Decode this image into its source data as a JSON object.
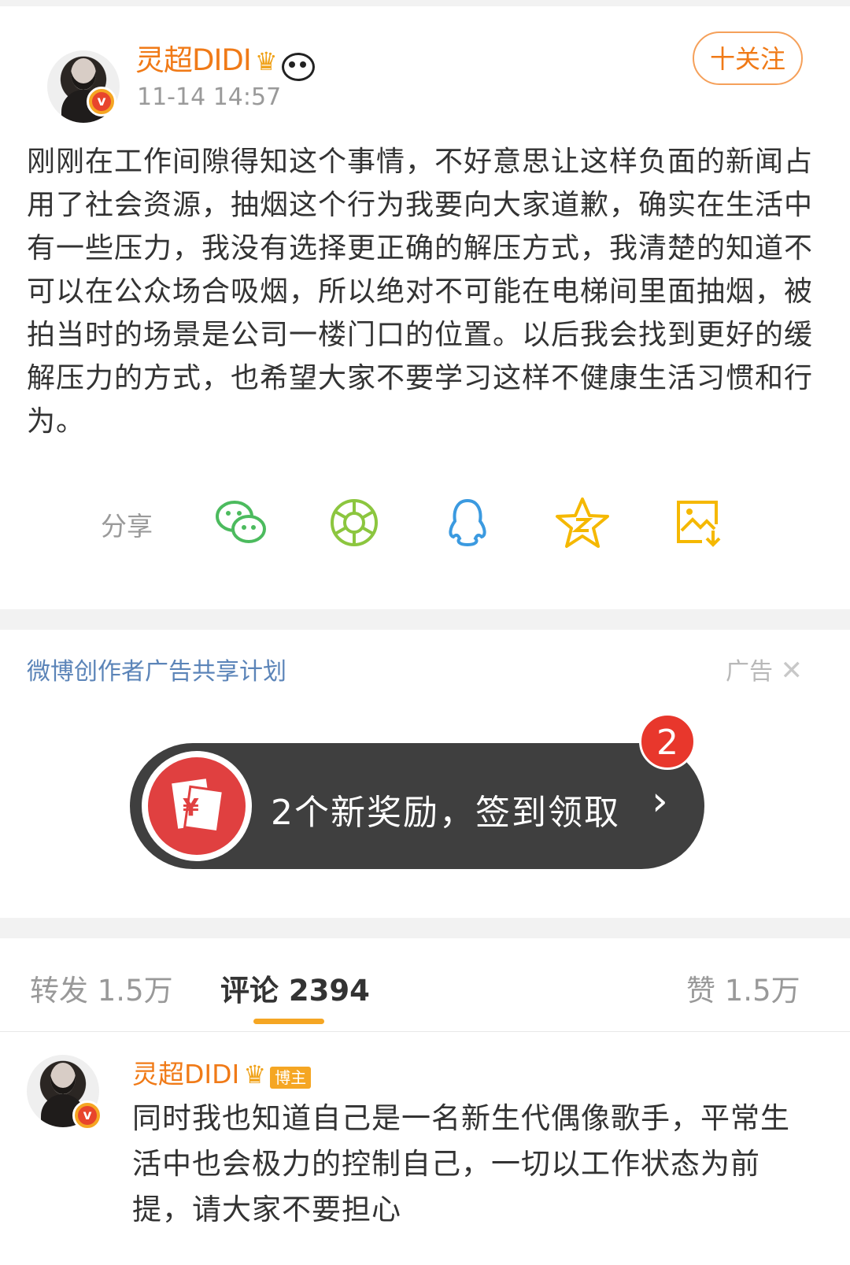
{
  "post": {
    "author": "灵超DIDI",
    "timestamp": "11-14 14:57",
    "follow_label": "十关注",
    "text": "刚刚在工作间隙得知这个事情，不好意思让这样负面的新闻占用了社会资源，抽烟这个行为我要向大家道歉，确实在生活中有一些压力，我没有选择更正确的解压方式，我清楚的知道不可以在公众场合吸烟，所以绝对不可能在电梯间里面抽烟，被拍当时的场景是公司一楼门口的位置。以后我会找到更好的缓解压力的方式，也希望大家不要学习这样不健康生活习惯和行为。"
  },
  "share": {
    "label": "分享",
    "icons": [
      "wechat-icon",
      "moments-icon",
      "qq-icon",
      "qzone-icon",
      "save-image-icon"
    ]
  },
  "ad": {
    "title": "微博创作者广告共享计划",
    "label": "广告",
    "reward_text": "2个新奖励，签到领取",
    "reward_count": "2"
  },
  "tabs": {
    "repost": "转发 1.5万",
    "comments": "评论 2394",
    "likes": "赞 1.5万"
  },
  "comment": {
    "author": "灵超DIDI",
    "badge": "博主",
    "text": "同时我也知道自己是一名新生代偶像歌手，平常生活中也会极力的控制自己，一切以工作状态为前提，请大家不要担心"
  },
  "colors": {
    "accent_orange": "#f07a17",
    "link_blue": "#5b84b8",
    "reward_bg": "#3f3f3f",
    "badge_red": "#e8372c"
  }
}
